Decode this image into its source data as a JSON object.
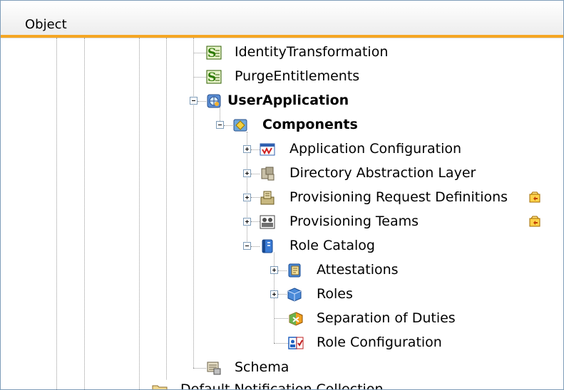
{
  "header": {
    "label": "Object"
  },
  "tree": [
    {
      "id": "identity-transformation",
      "label": "IdentityTransformation",
      "icon": "script-icon",
      "bold": false
    },
    {
      "id": "purge-entitlements",
      "label": "PurgeEntitlements",
      "icon": "script-icon",
      "bold": false
    },
    {
      "id": "user-application",
      "label": "UserApplication",
      "icon": "globe-app-icon",
      "bold": true,
      "expander": "collapse"
    },
    {
      "id": "components",
      "label": "Components",
      "icon": "components-icon",
      "bold": true,
      "expander": "collapse"
    },
    {
      "id": "application-configuration",
      "label": "Application Configuration",
      "icon": "app-config-icon",
      "expander": "expand"
    },
    {
      "id": "directory-abstraction-layer",
      "label": "Directory Abstraction Layer",
      "icon": "directory-abstraction-icon",
      "expander": "expand"
    },
    {
      "id": "provisioning-request-definitions",
      "label": "Provisioning Request Definitions",
      "icon": "provisioning-request-icon",
      "expander": "expand",
      "badge": "checkout-icon"
    },
    {
      "id": "provisioning-teams",
      "label": "Provisioning Teams",
      "icon": "provisioning-teams-icon",
      "expander": "expand",
      "badge": "checkout-icon"
    },
    {
      "id": "role-catalog",
      "label": "Role Catalog",
      "icon": "role-catalog-icon",
      "expander": "collapse"
    },
    {
      "id": "attestations",
      "label": "Attestations",
      "icon": "attestations-icon",
      "expander": "expand"
    },
    {
      "id": "roles",
      "label": "Roles",
      "icon": "roles-icon",
      "expander": "expand"
    },
    {
      "id": "separation-of-duties",
      "label": "Separation of Duties",
      "icon": "separation-of-duties-icon"
    },
    {
      "id": "role-configuration",
      "label": "Role Configuration",
      "icon": "role-configuration-icon"
    },
    {
      "id": "schema",
      "label": "Schema",
      "icon": "schema-icon"
    },
    {
      "id": "default-notification-collection",
      "label": "Default Notification Collection",
      "icon": "folder-icon"
    }
  ]
}
